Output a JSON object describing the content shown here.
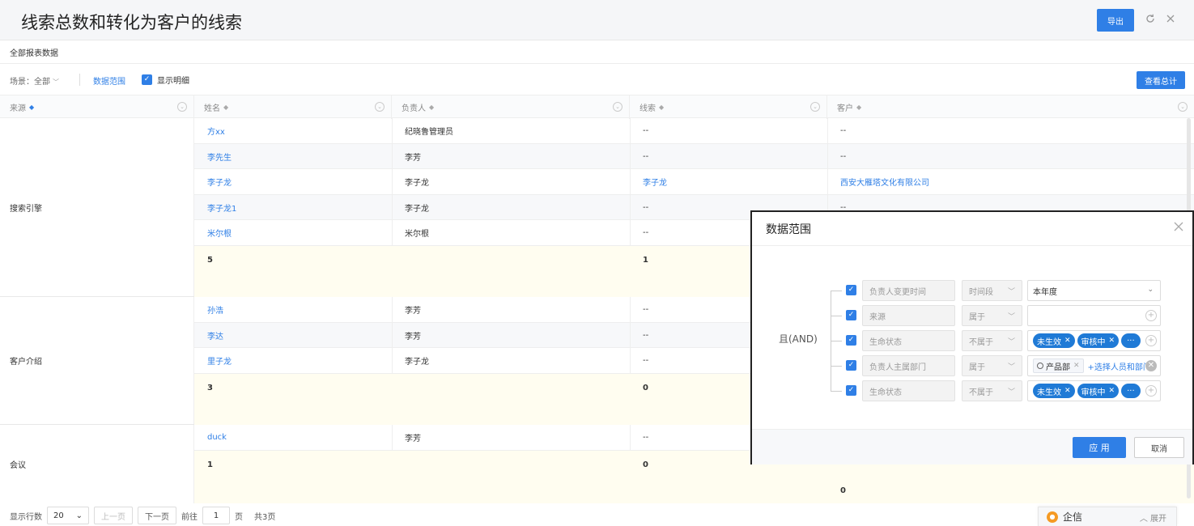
{
  "header": {
    "title": "线索总数和转化为客户的线索",
    "export_label": "导出",
    "refresh_icon": "refresh-icon",
    "close_icon": "close-icon"
  },
  "subtitle": "全部报表数据",
  "toolbar": {
    "scene_label": "场景：全部",
    "data_range_label": "数据范围",
    "show_detail_label": "显示明细",
    "view_total_label": "查看总计"
  },
  "table": {
    "columns": [
      {
        "label": "来源"
      },
      {
        "label": "姓名"
      },
      {
        "label": "负责人"
      },
      {
        "label": "线索"
      },
      {
        "label": "客户"
      }
    ],
    "groups": [
      {
        "label": "搜索引擎",
        "rows": [
          {
            "name": "方xx",
            "owner": "纪晓鲁管理员",
            "lead": "--",
            "customer": "--"
          },
          {
            "name": "李先生",
            "owner": "李芳",
            "lead": "--",
            "customer": "--"
          },
          {
            "name": "李子龙",
            "owner": "李子龙",
            "lead": "李子龙",
            "customer": "西安大雁塔文化有限公司"
          },
          {
            "name": "李子龙1",
            "owner": "李子龙",
            "lead": "--",
            "customer": "--"
          },
          {
            "name": "米尔根",
            "owner": "米尔根",
            "lead": "--",
            "customer": ""
          }
        ],
        "sum": {
          "name": "5",
          "lead": "1",
          "customer": ""
        }
      },
      {
        "label": "客户介绍",
        "rows": [
          {
            "name": "孙浩",
            "owner": "李芳",
            "lead": "--",
            "customer": ""
          },
          {
            "name": "李达",
            "owner": "李芳",
            "lead": "--",
            "customer": ""
          },
          {
            "name": "里子龙",
            "owner": "李子龙",
            "lead": "--",
            "customer": ""
          }
        ],
        "sum": {
          "name": "3",
          "lead": "0",
          "customer": ""
        }
      },
      {
        "label": "会议",
        "rows": [
          {
            "name": "duck",
            "owner": "李芳",
            "lead": "--",
            "customer": ""
          }
        ],
        "sum": {
          "name": "1",
          "lead": "0",
          "customer": "0"
        }
      }
    ]
  },
  "pagination": {
    "rows_label": "显示行数",
    "page_size": "20",
    "prev_label": "上一页",
    "next_label": "下一页",
    "goto_label": "前往",
    "page": "1",
    "page_unit": "页",
    "total_label": "共3页"
  },
  "qixin": {
    "label": "企信",
    "expand_label": "展开"
  },
  "modal": {
    "title": "数据范围",
    "and_label": "且(AND)",
    "conditions": [
      {
        "field": "负责人变更时间",
        "op": "时间段",
        "value": "本年度"
      },
      {
        "field": "来源",
        "op": "属于",
        "value": ""
      },
      {
        "field": "生命状态",
        "op": "不属于",
        "tags": [
          "未生效",
          "审核中",
          "···"
        ]
      },
      {
        "field": "负责人主属部门",
        "op": "属于",
        "dept": "产品部",
        "select_label": "+选择人员和部门"
      },
      {
        "field": "生命状态",
        "op": "不属于",
        "tags": [
          "未生效",
          "审核中",
          "···"
        ]
      }
    ],
    "apply_label": "应 用",
    "cancel_label": "取消"
  },
  "colors": {
    "accent": "#2f7fe6",
    "tag": "#1f7ad6",
    "sum_row": "#fffdf0"
  }
}
